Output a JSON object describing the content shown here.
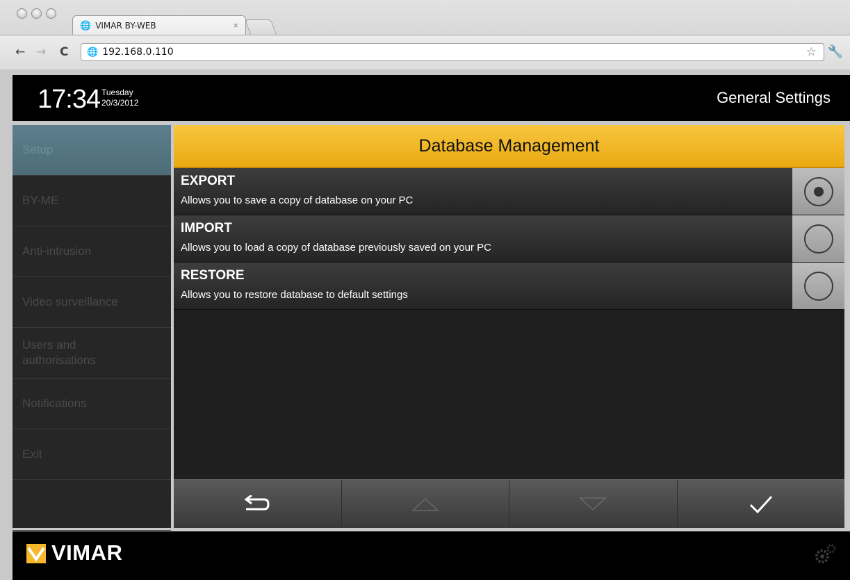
{
  "browser": {
    "tab_title": "VIMAR BY-WEB",
    "tab_close": "×",
    "url": "192.168.0.110",
    "back": "←",
    "forward": "→",
    "reload": "C",
    "bookmark_icon": "star-icon",
    "menu_icon": "wrench-icon"
  },
  "header": {
    "time": "17:34",
    "day": "Tuesday",
    "date": "20/3/2012",
    "title": "General Settings"
  },
  "sidebar": {
    "items": [
      {
        "label": "Setup",
        "active": true
      },
      {
        "label": "BY-ME"
      },
      {
        "label": "Anti-intrusion"
      },
      {
        "label": "Video surveillance"
      },
      {
        "label": "Users and authorisations"
      },
      {
        "label": "Notifications"
      },
      {
        "label": "Exit"
      },
      {
        "label": ""
      }
    ]
  },
  "main": {
    "title": "Database Management",
    "options": [
      {
        "name": "EXPORT",
        "description": "Allows you to save a copy of database on your PC",
        "selected": true
      },
      {
        "name": "IMPORT",
        "description": "Allows you to load a copy of database previously saved on your PC",
        "selected": false
      },
      {
        "name": "RESTORE",
        "description": "Allows you to restore database to default settings",
        "selected": false
      }
    ]
  },
  "bottom_bar": {
    "buttons": [
      "back-arrow-icon",
      "scroll-up-icon",
      "scroll-down-icon",
      "confirm-check-icon"
    ]
  },
  "footer": {
    "brand": "VIMAR",
    "settings_icon": "gear-icon"
  },
  "colors": {
    "accent": "#f5b82a",
    "active_sidebar": "#587987",
    "background": "#000000"
  }
}
